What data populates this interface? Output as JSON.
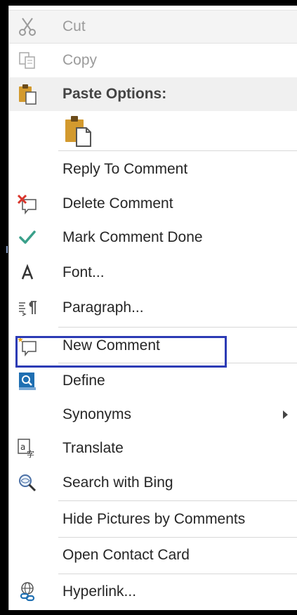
{
  "menu": {
    "cut": {
      "label": "Cut",
      "icon": "scissors-icon"
    },
    "copy": {
      "label": "Copy",
      "icon": "copy-icon"
    },
    "paste_options": {
      "label": "Paste Options:",
      "icon": "clipboard-icon"
    },
    "paste_keep": {
      "icon": "paste-keep-formatting-icon"
    },
    "reply_comment": {
      "label": "Reply To Comment"
    },
    "delete_comment": {
      "label": "Delete Comment",
      "icon": "delete-comment-icon"
    },
    "mark_done": {
      "label": "Mark Comment Done",
      "icon": "checkmark-icon"
    },
    "font": {
      "label": "Font...",
      "icon": "font-icon"
    },
    "paragraph": {
      "label": "Paragraph...",
      "icon": "paragraph-icon"
    },
    "new_comment": {
      "label": "New Comment",
      "icon": "new-comment-icon"
    },
    "define": {
      "label": "Define",
      "icon": "define-icon"
    },
    "synonyms": {
      "label": "Synonyms"
    },
    "translate": {
      "label": "Translate",
      "icon": "translate-icon"
    },
    "search_bing": {
      "label": "Search with Bing",
      "icon": "search-bing-icon"
    },
    "hide_pictures": {
      "label": "Hide Pictures by Comments"
    },
    "contact_card": {
      "label": "Open Contact Card"
    },
    "hyperlink": {
      "label": "Hyperlink...",
      "icon": "hyperlink-icon"
    }
  },
  "colors": {
    "highlight_border": "#2c3bb5",
    "check_green": "#3aa08a",
    "delete_red": "#d9342b",
    "define_blue": "#1f6fb2"
  }
}
